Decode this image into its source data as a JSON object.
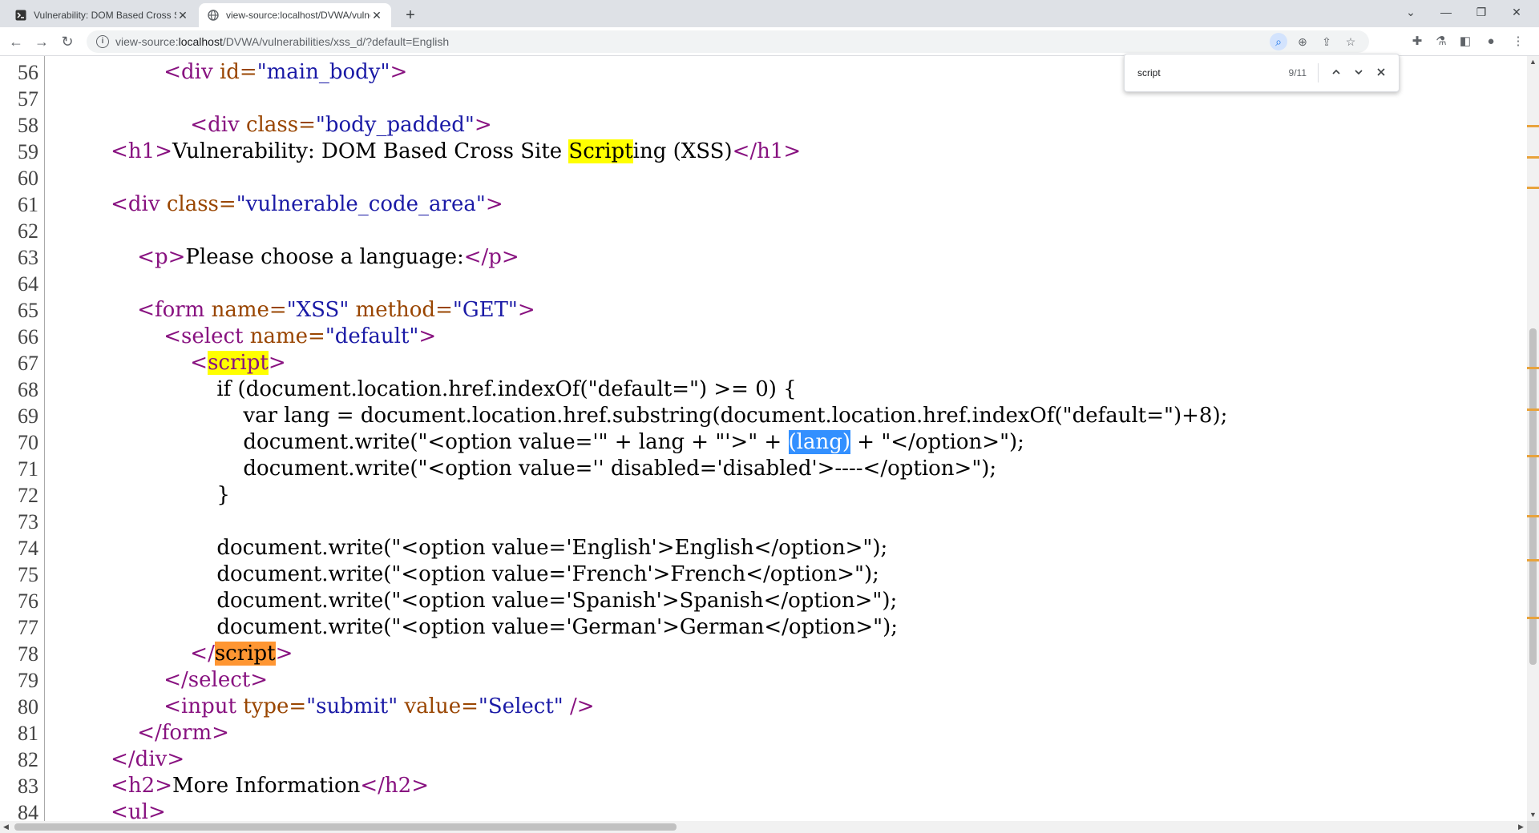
{
  "tabs": [
    {
      "title": "Vulnerability: DOM Based Cross Site Scripting (XSS)",
      "active": false,
      "icon": "terminal-icon"
    },
    {
      "title": "view-source:localhost/DVWA/vulnerabilities/xss_d/?default=English",
      "active": true,
      "icon": "globe-icon"
    }
  ],
  "address": {
    "scheme": "view-source:",
    "host": "localhost",
    "path": "/DVWA/vulnerabilities/xss_d/?default=English"
  },
  "find": {
    "query": "script",
    "count": "9/11"
  },
  "accent": "#1a73e8",
  "highlight_colors": {
    "match": "#ffff00",
    "current": "#ff9632",
    "selection": "#3390ff"
  },
  "source_lines": [
    {
      "num": "56",
      "segs": [
        [
          "",
          "                "
        ],
        [
          "tg",
          "<div "
        ],
        [
          "at",
          "id="
        ],
        [
          "av",
          "\"main_body\""
        ],
        [
          "tg",
          ">"
        ]
      ]
    },
    {
      "num": "57",
      "segs": []
    },
    {
      "num": "58",
      "segs": [
        [
          "",
          "                    "
        ],
        [
          "tg",
          "<div "
        ],
        [
          "at",
          "class="
        ],
        [
          "av",
          "\"body_padded\""
        ],
        [
          "tg",
          ">"
        ]
      ]
    },
    {
      "num": "59",
      "segs": [
        [
          "",
          "        "
        ],
        [
          "tg",
          "<h1>"
        ],
        [
          "",
          "Vulnerability: DOM Based Cross Site "
        ],
        [
          "hl",
          "Script"
        ],
        [
          "",
          "ing (XSS)"
        ],
        [
          "tg",
          "</h1>"
        ]
      ]
    },
    {
      "num": "60",
      "segs": []
    },
    {
      "num": "61",
      "segs": [
        [
          "",
          "        "
        ],
        [
          "tg",
          "<div "
        ],
        [
          "at",
          "class="
        ],
        [
          "av",
          "\"vulnerable_code_area\""
        ],
        [
          "tg",
          ">"
        ]
      ]
    },
    {
      "num": "62",
      "segs": []
    },
    {
      "num": "63",
      "segs": [
        [
          "",
          "            "
        ],
        [
          "tg",
          "<p>"
        ],
        [
          "",
          "Please choose a language:"
        ],
        [
          "tg",
          "</p>"
        ]
      ]
    },
    {
      "num": "64",
      "segs": []
    },
    {
      "num": "65",
      "segs": [
        [
          "",
          "            "
        ],
        [
          "tg",
          "<form "
        ],
        [
          "at",
          "name="
        ],
        [
          "av",
          "\"XSS\""
        ],
        [
          "at",
          " method="
        ],
        [
          "av",
          "\"GET\""
        ],
        [
          "tg",
          ">"
        ]
      ]
    },
    {
      "num": "66",
      "segs": [
        [
          "",
          "                "
        ],
        [
          "tg",
          "<select "
        ],
        [
          "at",
          "name="
        ],
        [
          "av",
          "\"default\""
        ],
        [
          "tg",
          ">"
        ]
      ]
    },
    {
      "num": "67",
      "segs": [
        [
          "",
          "                    "
        ],
        [
          "tg",
          "<"
        ],
        [
          "hltg",
          "script"
        ],
        [
          "tg",
          ">"
        ]
      ]
    },
    {
      "num": "68",
      "segs": [
        [
          "",
          "                        if (document.location.href.indexOf(\"default=\") >= 0) {"
        ]
      ]
    },
    {
      "num": "69",
      "segs": [
        [
          "",
          "                            var lang = document.location.href.substring(document.location.href.indexOf(\"default=\")+8);"
        ]
      ]
    },
    {
      "num": "70",
      "segs": [
        [
          "",
          "                            document.write(\"<option value='\" + lang + \"'>\" + "
        ],
        [
          "sel",
          "(lang)"
        ],
        [
          "",
          " + \"</option>\");"
        ]
      ]
    },
    {
      "num": "71",
      "segs": [
        [
          "",
          "                            document.write(\"<option value='' disabled='disabled'>----</option>\");"
        ]
      ]
    },
    {
      "num": "72",
      "segs": [
        [
          "",
          "                        }"
        ]
      ]
    },
    {
      "num": "73",
      "segs": []
    },
    {
      "num": "74",
      "segs": [
        [
          "",
          "                        document.write(\"<option value='English'>English</option>\");"
        ]
      ]
    },
    {
      "num": "75",
      "segs": [
        [
          "",
          "                        document.write(\"<option value='French'>French</option>\");"
        ]
      ]
    },
    {
      "num": "76",
      "segs": [
        [
          "",
          "                        document.write(\"<option value='Spanish'>Spanish</option>\");"
        ]
      ]
    },
    {
      "num": "77",
      "segs": [
        [
          "",
          "                        document.write(\"<option value='German'>German</option>\");"
        ]
      ]
    },
    {
      "num": "78",
      "segs": [
        [
          "",
          "                    "
        ],
        [
          "tg",
          "</"
        ],
        [
          "cur",
          "script"
        ],
        [
          "tg",
          ">"
        ]
      ]
    },
    {
      "num": "79",
      "segs": [
        [
          "",
          "                "
        ],
        [
          "tg",
          "</select>"
        ]
      ]
    },
    {
      "num": "80",
      "segs": [
        [
          "",
          "                "
        ],
        [
          "tg",
          "<input "
        ],
        [
          "at",
          "type="
        ],
        [
          "av",
          "\"submit\""
        ],
        [
          "at",
          " value="
        ],
        [
          "av",
          "\"Select\""
        ],
        [
          "tg",
          " />"
        ]
      ]
    },
    {
      "num": "81",
      "segs": [
        [
          "",
          "            "
        ],
        [
          "tg",
          "</form>"
        ]
      ]
    },
    {
      "num": "82",
      "segs": [
        [
          "",
          "        "
        ],
        [
          "tg",
          "</div>"
        ]
      ]
    },
    {
      "num": "83",
      "segs": [
        [
          "",
          "        "
        ],
        [
          "tg",
          "<h2>"
        ],
        [
          "",
          "More Information"
        ],
        [
          "tg",
          "</h2>"
        ]
      ]
    },
    {
      "num": "84",
      "segs": [
        [
          "",
          "        "
        ],
        [
          "tg",
          "<ul>"
        ]
      ]
    }
  ]
}
